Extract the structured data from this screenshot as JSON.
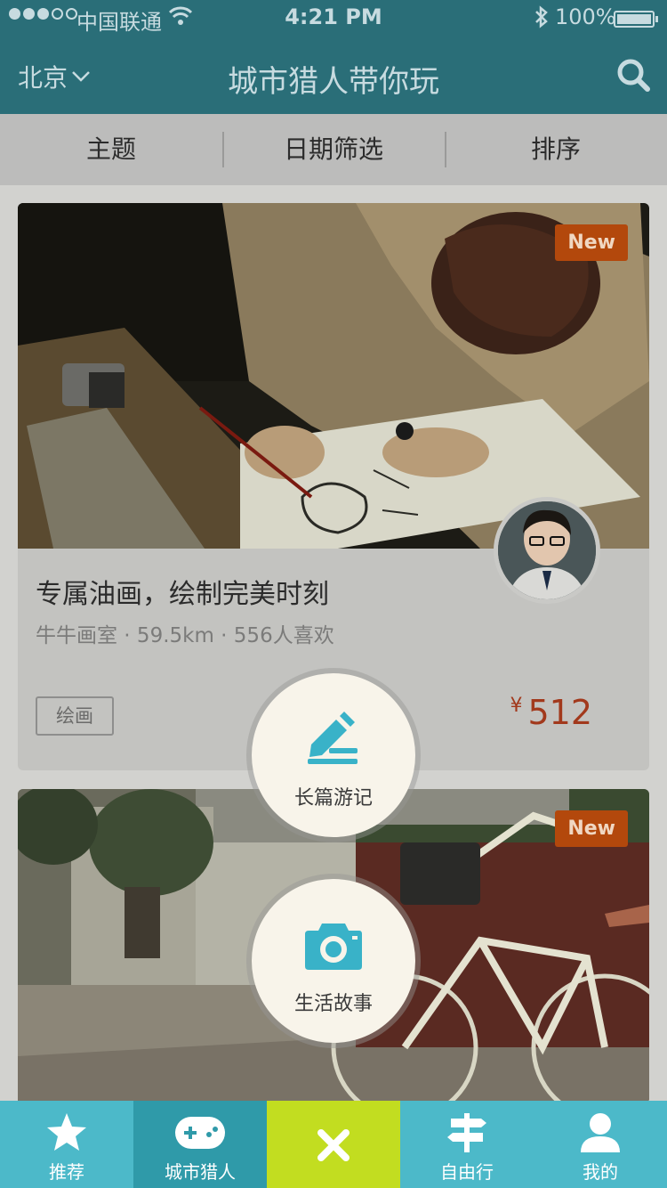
{
  "status_bar": {
    "carrier": "中国联通",
    "time": "4:21 PM",
    "battery": "100%"
  },
  "nav": {
    "city": "北京",
    "title": "城市猎人带你玩",
    "icons": [
      "chevron-down-icon",
      "search-icon"
    ]
  },
  "filters": [
    {
      "label": "主题"
    },
    {
      "label": "日期筛选"
    },
    {
      "label": "排序"
    }
  ],
  "cards": [
    {
      "badge": "New",
      "title": "专属油画，绘制完美时刻",
      "meta": "牛牛画室 · 59.5km · 556人喜欢",
      "tag": "绘画",
      "currency": "¥",
      "price": "512"
    },
    {
      "badge": "New"
    }
  ],
  "fab_menu": [
    {
      "label": "长篇游记",
      "icon": "pencil-icon"
    },
    {
      "label": "生活故事",
      "icon": "camera-icon"
    }
  ],
  "tabbar": [
    {
      "label": "推荐",
      "icon": "star-icon"
    },
    {
      "label": "城市猎人",
      "icon": "gamepad-icon",
      "active": true
    },
    {
      "label": "",
      "icon": "close-icon"
    },
    {
      "label": "自由行",
      "icon": "signpost-icon"
    },
    {
      "label": "我的",
      "icon": "user-icon"
    }
  ],
  "colors": {
    "header": "#2a6e78",
    "tabbar": "#4cb9c9",
    "tab_active": "#2f9aa9",
    "tab_center": "#c2dd20",
    "badge": "#b3480c",
    "price": "#a2391c",
    "fab_icon": "#39b2c8"
  }
}
